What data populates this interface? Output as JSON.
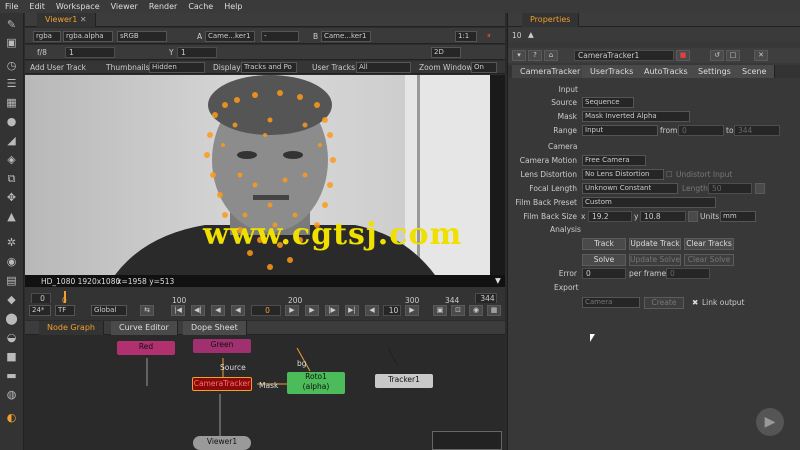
{
  "menu": [
    "File",
    "Edit",
    "Workspace",
    "Viewer",
    "Render",
    "Cache",
    "Help"
  ],
  "viewer_tab": "Viewer1",
  "viewer_toolbar": {
    "channel": "rgba",
    "alpha": "rgba.alpha",
    "colorspace": "sRGB",
    "a_label": "A",
    "a_input": "Came...ker1",
    "a_op": "-",
    "b_label": "B",
    "b_input": "Came...ker1",
    "zoom": "1:1",
    "fstop": "f/8",
    "gain": "1",
    "y_label": "Y",
    "gamma": "1",
    "view_mode": "2D"
  },
  "tracker_toolbar": {
    "add_user_track": "Add User Track",
    "thumbnails_label": "Thumbnails",
    "thumbnails_value": "Hidden",
    "display_label": "Display",
    "display_value": "Tracks and Po",
    "user_tracks_label": "User Tracks",
    "user_tracks_value": "All",
    "zoom_window_label": "Zoom Window",
    "zoom_window_value": "On"
  },
  "viewer_info": {
    "format": "HD_1080 1920x1080",
    "coords": "x=1958 y=513"
  },
  "watermark": "www.cgtsj.com",
  "timeline": {
    "start": "0",
    "ticks": [
      "0",
      "100",
      "200",
      "300",
      "344"
    ],
    "end": "344",
    "fps": "24*",
    "tf": "TF",
    "scope": "Global",
    "current_frame": "0",
    "step": "10"
  },
  "bottom_tabs": [
    "Node Graph",
    "Curve Editor",
    "Dope Sheet"
  ],
  "nodes": {
    "red": "Red",
    "green": "Green",
    "source": "Source",
    "camera_tracker": "CameraTracker",
    "mask": "Mask",
    "roto": "Roto1",
    "roto_sub": "(alpha)",
    "tracker": "Tracker1",
    "viewer": "Viewer1",
    "bg_label": "bg"
  },
  "properties": {
    "title": "Properties",
    "count": "10",
    "node_name": "CameraTracker1",
    "tabs": [
      "CameraTracker",
      "UserTracks",
      "AutoTracks",
      "Settings",
      "Scene"
    ],
    "sections": {
      "input": "Input",
      "camera": "Camera",
      "analysis": "Analysis",
      "export": "Export"
    },
    "source_label": "Source",
    "source_value": "Sequence",
    "mask_label": "Mask",
    "mask_value": "Mask Inverted Alpha",
    "range_label": "Range",
    "range_value": "Input",
    "range_from_label": "from",
    "range_from": "0",
    "range_to_label": "to",
    "range_to": "344",
    "camera_motion_label": "Camera Motion",
    "camera_motion_value": "Free Camera",
    "lens_distortion_label": "Lens Distortion",
    "lens_distortion_value": "No Lens Distortion",
    "undistort_label": "Undistort Input",
    "focal_length_label": "Focal Length",
    "focal_length_value": "Unknown Constant",
    "length_label": "Length",
    "length_value": "50",
    "film_back_preset_label": "Film Back Preset",
    "film_back_preset_value": "Custom",
    "film_back_size_label": "Film Back Size",
    "fbs_x_label": "x",
    "fbs_x": "19.2",
    "fbs_y_label": "y",
    "fbs_y": "10.8",
    "units_label": "Units",
    "units_value": "mm",
    "track_btn": "Track",
    "update_track_btn": "Update Track",
    "clear_tracks_btn": "Clear Tracks",
    "solve_btn": "Solve",
    "update_solve_btn": "Update Solve",
    "clear_solve_btn": "Clear Solve",
    "error_label": "Error",
    "error_value": "0",
    "per_frame_label": "per frame",
    "per_frame_value": "0",
    "export_value": "Camera",
    "create_btn": "Create",
    "link_output_label": "Link output"
  },
  "colors": {
    "accent": "#f0a030",
    "track_points": "#ff9a1a",
    "watermark": "#f0e000",
    "node_red": "#b03070",
    "node_green": "#a03070",
    "node_camtracker": "#8a0a0a",
    "node_roto": "#4cbb5a",
    "node_tracker": "#c8c8c8",
    "node_viewer": "#9a9a9a"
  }
}
